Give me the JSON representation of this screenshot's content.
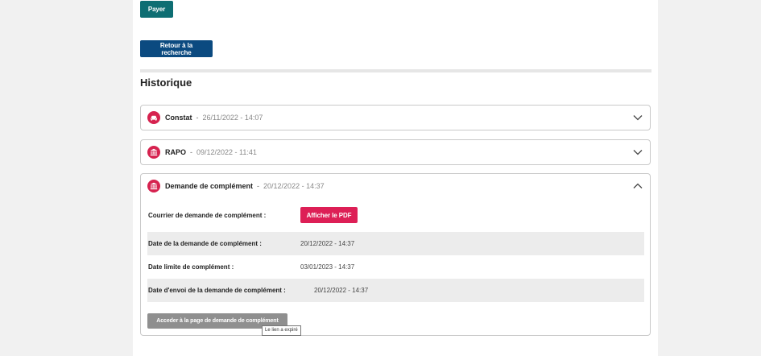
{
  "actions": {
    "pay_label": "Payer",
    "back_label": "Retour à la recherche"
  },
  "history": {
    "title": "Historique",
    "entries": [
      {
        "title": "Constat",
        "separator": "-",
        "date": "26/11/2022 - 14:07",
        "icon": "car-icon",
        "expanded": false
      },
      {
        "title": "RAPO",
        "separator": "-",
        "date": "09/12/2022 - 11:41",
        "icon": "institution-icon",
        "expanded": false
      },
      {
        "title": "Demande de complément",
        "separator": "-",
        "date": "20/12/2022 - 14:37",
        "icon": "institution-icon",
        "expanded": true,
        "letter_label": "Courrier de demande de complément :",
        "pdf_button": "Afficher le PDF",
        "rows": [
          {
            "label": "Date de la demande de complément :",
            "value": "20/12/2022 - 14:37"
          },
          {
            "label": "Date limite de complément :",
            "value": "03/01/2023 - 14:37"
          },
          {
            "label": "Date d'envoi de la demande de complément :",
            "value": "20/12/2022 - 14:37"
          }
        ],
        "access_button": "Acceder à la page de demande de complément",
        "tooltip": "Le lien a expiré"
      }
    ]
  },
  "colors": {
    "accent": "#dd1f56",
    "primary": "#0b4a80",
    "pay": "#0e6e73",
    "disabled": "#8f8f8f"
  }
}
